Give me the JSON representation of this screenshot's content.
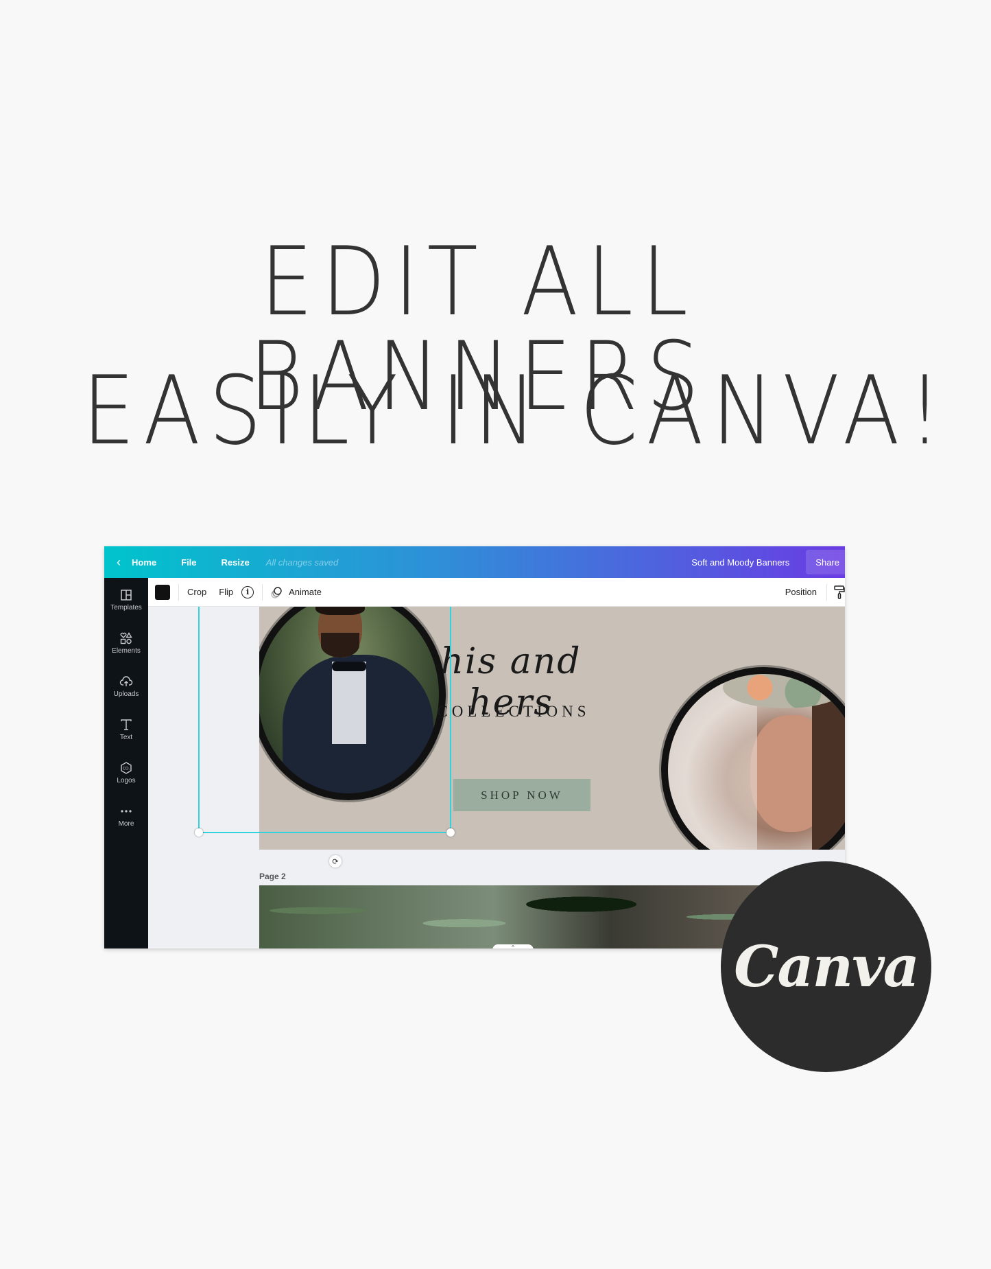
{
  "headline": {
    "line1": "EDIT ALL BANNERS",
    "line2": "EASILY IN CANVA!"
  },
  "editor": {
    "topbar": {
      "back_icon": "chevron-left-icon",
      "home": "Home",
      "file": "File",
      "resize": "Resize",
      "save_status": "All changes saved",
      "document_title": "Soft and Moody Banners",
      "share": "Share",
      "gradient": [
        "#00c4cc",
        "#2f8fd8",
        "#6a3ce3"
      ]
    },
    "sidebar": {
      "items": [
        {
          "label": "Templates",
          "icon": "templates-icon"
        },
        {
          "label": "Elements",
          "icon": "elements-icon"
        },
        {
          "label": "Uploads",
          "icon": "upload-cloud-icon"
        },
        {
          "label": "Text",
          "icon": "text-icon"
        },
        {
          "label": "Logos",
          "icon": "logo-badge-icon"
        },
        {
          "label": "More",
          "icon": "more-dots-icon"
        }
      ]
    },
    "toolbar": {
      "color_swatch": "#111111",
      "crop": "Crop",
      "flip": "Flip",
      "info_icon": "i",
      "animate": "Animate",
      "position": "Position",
      "paint_roller_icon": "paint-roller-icon"
    },
    "page1": {
      "script_title": "his and hers",
      "subtitle": "COLLECTIONS",
      "cta": "SHOP NOW",
      "background": "#c9c1b8",
      "cta_color": "#9aad9f"
    },
    "page2": {
      "label": "Page 2"
    }
  },
  "badge": {
    "text": "Canva",
    "background": "#2c2c2c"
  }
}
